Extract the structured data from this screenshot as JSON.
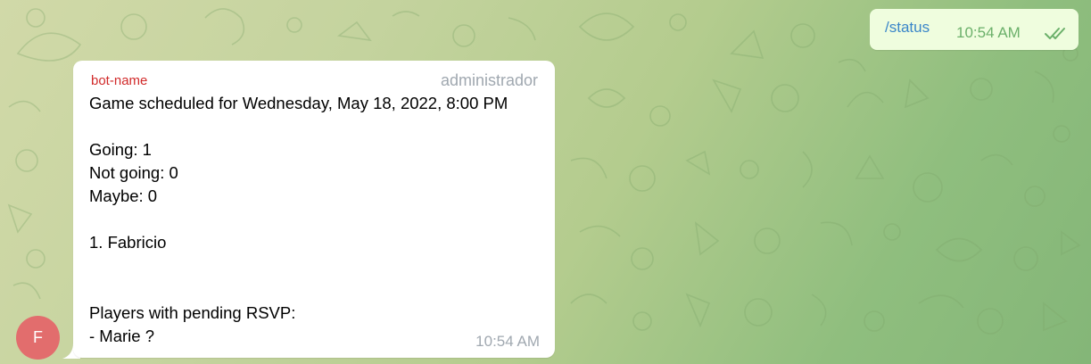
{
  "outgoing": {
    "text": "/status",
    "time": "10:54 AM",
    "status_icon": "double-check-icon"
  },
  "incoming": {
    "sender": "bot-name",
    "role": "administrador",
    "lines": [
      "Game scheduled for Wednesday, May 18, 2022, 8:00 PM",
      "Going: 1",
      "Not going: 0",
      "Maybe: 0",
      "1. Fabricio",
      "Players with pending RSVP:",
      "- Marie ?"
    ],
    "time": "10:54 AM",
    "avatar_letter": "F"
  },
  "colors": {
    "sender": "#d12a2a",
    "outgoing_bubble": "#effdde",
    "command_link": "#3a86c9",
    "avatar": "#e26d6d"
  }
}
